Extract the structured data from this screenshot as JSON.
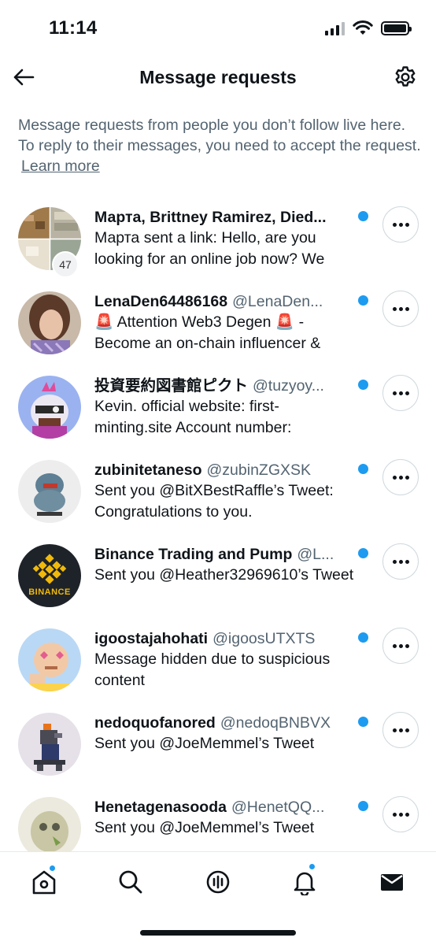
{
  "status_bar": {
    "time": "11:14"
  },
  "header": {
    "title": "Message requests"
  },
  "intro": {
    "text": "Message requests from people you don’t follow live here. To reply to their messages, you need to accept the request.",
    "link": "Learn more"
  },
  "requests": [
    {
      "name": "Марта, Brittney Ramirez, Died...",
      "handle": "",
      "message": "Марта sent a link: Hello, are you looking for an online job now? We",
      "badge": "47",
      "unread": true
    },
    {
      "name": "LenaDen64486168",
      "handle": "@LenaDen...",
      "message": "🚨 Attention Web3 Degen 🚨 - Become an on-chain influencer &",
      "unread": true
    },
    {
      "name": "投資要約図書館ピクト",
      "handle": "@tuzyoy...",
      "message": "Kevin. official website: first-minting.site Account number:",
      "unread": true
    },
    {
      "name": "zubinitetaneso",
      "handle": "@zubinZGXSK",
      "message": "Sent you @BitXBestRaffle’s Tweet: Congratulations to you.",
      "unread": true
    },
    {
      "name": "Binance Trading and Pump",
      "handle": "@L...",
      "message": "Sent you @Heather32969610’s Tweet",
      "avatar_text": "BINANCE",
      "unread": true
    },
    {
      "name": "igoostajahohati",
      "handle": "@igoosUTXTS",
      "message": "Message hidden due to suspicious content",
      "unread": true
    },
    {
      "name": "nedoquofanored",
      "handle": "@nedoqBNBVX",
      "message": "Sent you @JoeMemmel’s Tweet",
      "unread": true
    },
    {
      "name": "Henetagenasooda",
      "handle": "@HenetQQ...",
      "message": "Sent you @JoeMemmel’s Tweet",
      "unread": true
    }
  ],
  "tabbar": {
    "tabs": [
      {
        "name": "home",
        "icon": "home-icon",
        "notify": true
      },
      {
        "name": "search",
        "icon": "search-icon",
        "notify": false
      },
      {
        "name": "spaces",
        "icon": "spaces-icon",
        "notify": false
      },
      {
        "name": "notifications",
        "icon": "bell-icon",
        "notify": true
      },
      {
        "name": "messages",
        "icon": "envelope-icon",
        "notify": false
      }
    ]
  },
  "colors": {
    "accent": "#1d9bf0",
    "text": "#0f1419",
    "secondary": "#536471",
    "border": "#cfd9de"
  }
}
